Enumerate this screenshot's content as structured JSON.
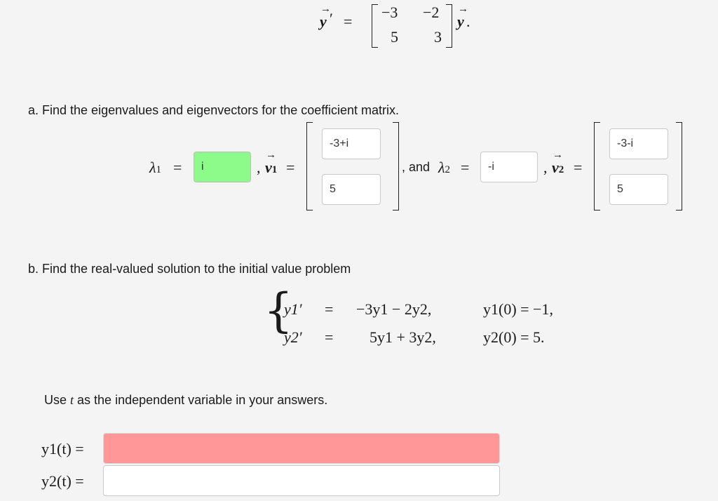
{
  "top_equation": {
    "lhs": "y",
    "prime": "′",
    "equals": "=",
    "matrix": [
      [
        "−3",
        "−2"
      ],
      [
        "5",
        "3"
      ]
    ],
    "rhs": "y",
    "period": "."
  },
  "part_a": {
    "prompt": "a. Find the eigenvalues and eigenvectors for the coefficient matrix.",
    "lambda_symbol": "λ",
    "sub1": "1",
    "sub2": "2",
    "equals": "=",
    "comma": ",",
    "v_symbol": "v",
    "and_text": ", and",
    "lambda1_value": "i",
    "v1": [
      "-3+i",
      "5"
    ],
    "lambda2_value": "-i",
    "v2": [
      "-3-i",
      "5"
    ]
  },
  "part_b": {
    "prompt": "b. Find the real-valued solution to the initial value problem",
    "system": {
      "brace": "{",
      "rows": [
        {
          "lhs": "y1′",
          "eq": "=",
          "rhs": "−3y1 − 2y2,",
          "ic": "y1(0) = −1,"
        },
        {
          "lhs": "y2′",
          "eq": "=",
          "rhs": "5y1 + 3y2,",
          "ic": "y2(0) = 5."
        }
      ]
    }
  },
  "instruction": {
    "before": "Use ",
    "variable": "t",
    "after": " as the independent variable in your answers."
  },
  "answers": {
    "y1_label": "y1(t) =",
    "y1_value": "",
    "y2_label": "y2(t) =",
    "y2_value": ""
  }
}
